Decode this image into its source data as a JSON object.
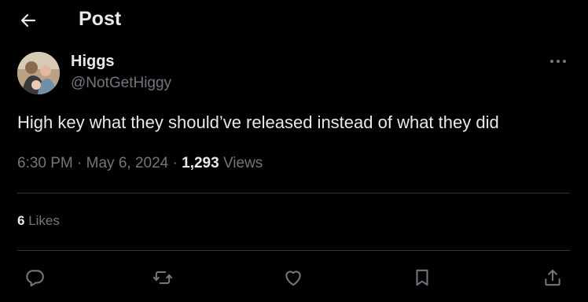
{
  "header": {
    "title": "Post",
    "back_icon": "arrow-left-icon"
  },
  "author": {
    "display_name": "Higgs",
    "handle": "@NotGetHiggy",
    "avatar_icon": "avatar-photo"
  },
  "post": {
    "text": "High key what they should’ve released instead of what they did",
    "time": "6:30 PM",
    "separator": "·",
    "date": "May 6, 2024",
    "views_count": "1,293",
    "views_label": "Views"
  },
  "engagement": {
    "likes_count": "6",
    "likes_label": "Likes"
  },
  "actions": [
    {
      "name": "reply",
      "icon": "reply-icon"
    },
    {
      "name": "repost",
      "icon": "repost-icon"
    },
    {
      "name": "like",
      "icon": "heart-icon"
    },
    {
      "name": "bookmark",
      "icon": "bookmark-icon"
    },
    {
      "name": "share",
      "icon": "share-icon"
    }
  ],
  "colors": {
    "background": "#000000",
    "primary_text": "#e7e9ea",
    "secondary_text": "#71767b",
    "divider": "#2f3336"
  }
}
